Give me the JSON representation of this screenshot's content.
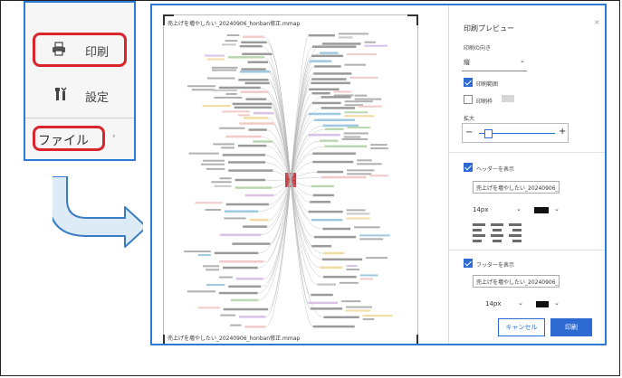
{
  "menu": {
    "print_label": "印刷",
    "settings_label": "設定",
    "file_label": "ファイル"
  },
  "preview": {
    "title_top": "売上げを増やしたい_20240906_honban修正.mmap",
    "title_bottom": "売上げを増やしたい_20240906_honban修正.mmap"
  },
  "panel": {
    "title": "印刷プレビュー",
    "orientation_label": "印刷の向き",
    "orientation_value": "縦",
    "print_range_label": "印刷範囲",
    "print_frame_label": "印刷枠",
    "zoom_label": "拡大",
    "zoom_minus": "−",
    "zoom_plus": "+",
    "header_label": "ヘッダーを表示",
    "header_text": "売上げを増やしたい_20240906_",
    "header_size": "14px",
    "footer_label": "フッターを表示",
    "footer_text": "売上げを増やしたい_20240906_",
    "footer_size": "14px",
    "cancel_label": "キャンセル",
    "print_label": "印刷"
  },
  "colors": {
    "accent": "#2d6bd2",
    "highlight_red": "#d9262c",
    "frame_blue": "#2b7bd6"
  }
}
